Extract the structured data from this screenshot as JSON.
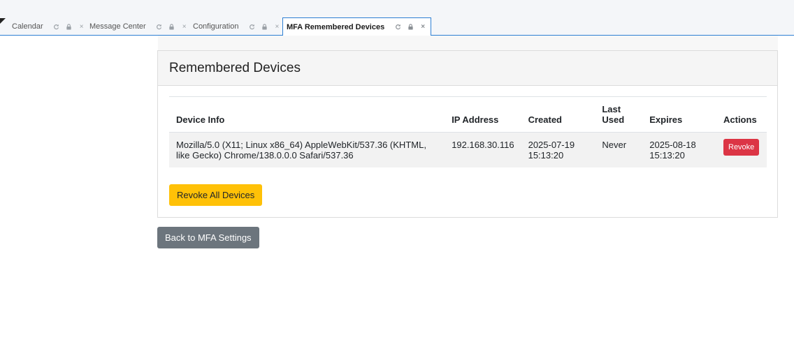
{
  "tabs": [
    {
      "label": "Calendar",
      "active": false
    },
    {
      "label": "Message Center",
      "active": false
    },
    {
      "label": "Configuration",
      "active": false
    },
    {
      "label": "MFA Remembered Devices",
      "active": true
    }
  ],
  "tab_icons": {
    "refresh": "refresh-icon",
    "lock": "lock-icon",
    "close": "close-icon",
    "close_glyph": "×"
  },
  "card": {
    "title": "Remembered Devices"
  },
  "table": {
    "headers": [
      "Device Info",
      "IP Address",
      "Created",
      "Last Used",
      "Expires",
      "Actions"
    ],
    "rows": [
      {
        "device_info": "Mozilla/5.0 (X11; Linux x86_64) AppleWebKit/537.36 (KHTML, like Gecko) Chrome/138.0.0.0 Safari/537.36",
        "ip_address": "192.168.30.116",
        "created": "2025-07-19 15:13:20",
        "last_used": "Never",
        "expires": "2025-08-18 15:13:20",
        "action_label": "Revoke"
      }
    ]
  },
  "buttons": {
    "revoke_all": "Revoke All Devices",
    "back": "Back to MFA Settings"
  },
  "colors": {
    "accent": "#2d7fd3",
    "danger": "#dc3545",
    "warning": "#ffc107",
    "secondary": "#6c757d"
  }
}
